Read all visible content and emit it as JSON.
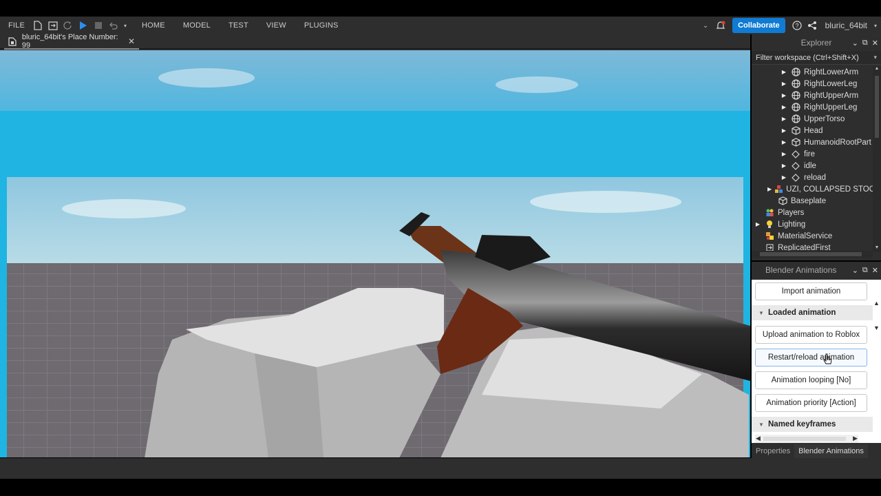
{
  "menu": {
    "file": "FILE",
    "tabs": [
      "HOME",
      "MODEL",
      "TEST",
      "VIEW",
      "PLUGINS"
    ],
    "collaborate": "Collaborate",
    "username": "bluric_64bit"
  },
  "document_tab": {
    "title": "bluric_64bit's Place Number: 99"
  },
  "explorer": {
    "title": "Explorer",
    "filter_placeholder": "Filter workspace (Ctrl+Shift+X)",
    "items": [
      {
        "label": "RightLowerArm",
        "icon": "mesh-icon"
      },
      {
        "label": "RightLowerLeg",
        "icon": "mesh-icon"
      },
      {
        "label": "RightUpperArm",
        "icon": "mesh-icon"
      },
      {
        "label": "RightUpperLeg",
        "icon": "mesh-icon"
      },
      {
        "label": "UpperTorso",
        "icon": "mesh-icon"
      },
      {
        "label": "Head",
        "icon": "part-icon"
      },
      {
        "label": "HumanoidRootPart",
        "icon": "part-icon"
      },
      {
        "label": "fire",
        "icon": "keyframe-icon"
      },
      {
        "label": "idle",
        "icon": "keyframe-icon"
      },
      {
        "label": "reload",
        "icon": "keyframe-icon"
      },
      {
        "label": "UZI, COLLAPSED STOCK",
        "icon": "model-icon"
      },
      {
        "label": "Baseplate",
        "icon": "part-icon"
      },
      {
        "label": "Players",
        "icon": "players-icon"
      },
      {
        "label": "Lighting",
        "icon": "lighting-icon"
      },
      {
        "label": "MaterialService",
        "icon": "material-icon"
      },
      {
        "label": "ReplicatedFirst",
        "icon": "replicated-icon"
      }
    ]
  },
  "blender": {
    "title": "Blender Animations",
    "import_label": "Import animation",
    "loaded_section": "Loaded animation",
    "upload_label": "Upload animation to Roblox",
    "restart_label": "Restart/reload animation",
    "looping_label": "Animation looping [No]",
    "priority_label": "Animation priority [Action]",
    "keyframes_section": "Named keyframes"
  },
  "bottom_tabs": {
    "properties": "Properties",
    "blender": "Blender Animations"
  },
  "colors": {
    "accent": "#0f7bd3",
    "sky": "#1fb4e2",
    "studio_bg": "#2e2e2e"
  }
}
